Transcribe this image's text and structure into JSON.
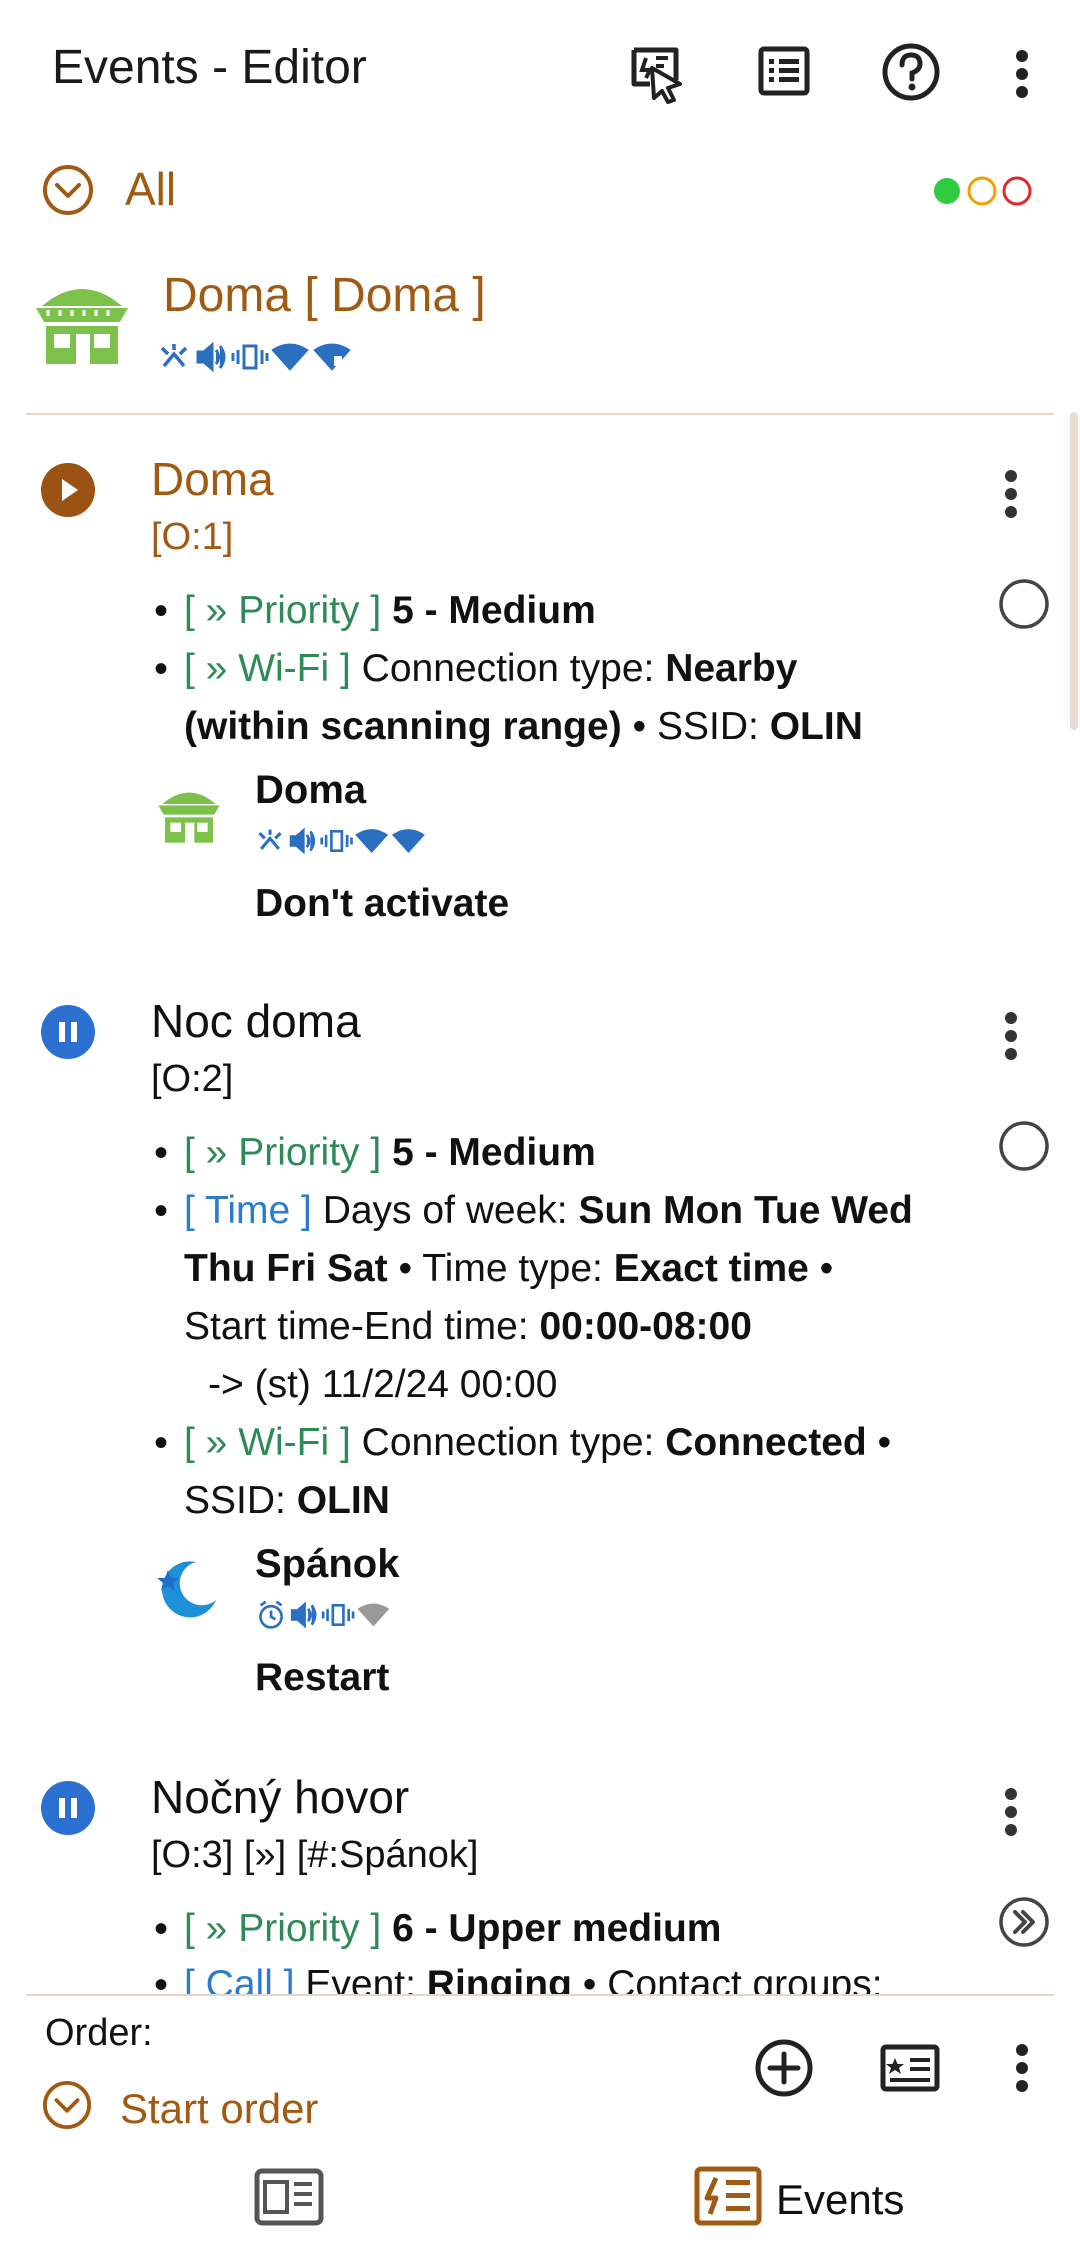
{
  "app": {
    "title": "Events - Editor",
    "toolbar_icons": [
      "run-events-icon",
      "list-icon",
      "help-icon",
      "more-vert-icon"
    ]
  },
  "filter": {
    "label": "All",
    "indicator_colors": [
      "#2ecc40",
      "#f0a000",
      "#e0282e"
    ]
  },
  "active_profile": {
    "name": "Doma [ Doma ]",
    "icon": "house-icon",
    "status_icons": [
      "airplane-mode-icon",
      "volume-icon",
      "vibrate-icon",
      "wifi-icon",
      "mobile-data-icon"
    ]
  },
  "events": [
    {
      "name": "Doma",
      "tag": "[O:1]",
      "state": "running",
      "priority_label": "[ » Priority ]",
      "priority_value": "5 - Medium",
      "wifi_label": "[ » Wi-Fi ]",
      "wifi_line1_text": "Connection type: ",
      "wifi_line1_value": "Nearby",
      "wifi_line2_value": "(within scanning range)",
      "wifi_line2_text": " • SSID: ",
      "wifi_ssid": "OLIN",
      "profile_name": "Doma",
      "profile_action": "Don't activate"
    },
    {
      "name": "Noc doma",
      "tag": "[O:2]",
      "state": "paused",
      "priority_label": "[ » Priority ]",
      "priority_value": "5 - Medium",
      "time_label": "[ Time ]",
      "time_text1": "Days of week: ",
      "time_days1": "Sun Mon Tue Wed",
      "time_days2": "Thu Fri Sat",
      "time_text2": " • Time type: ",
      "time_type": "Exact time",
      "time_text3": " •",
      "time_text4": "Start time-End time: ",
      "time_range": "00:00-08:00",
      "time_next": "-> (st) 11/2/24 00:00",
      "wifi_label": "[ » Wi-Fi ]",
      "wifi_text": "Connection type: ",
      "wifi_value": "Connected",
      "wifi_text2": " •",
      "wifi_ssid_text": "SSID: ",
      "wifi_ssid": "OLIN",
      "profile_name": "Spánok",
      "profile_action": "Restart"
    },
    {
      "name": "Nočný hovor",
      "tag": "[O:3] [»] [#:Spánok]",
      "state": "paused",
      "priority_label": "[ » Priority ]",
      "priority_value": "6 - Upper medium",
      "call_label": "[ Call ]",
      "call_text": "Event: ",
      "call_value": "Ringing",
      "call_text2": " • Contact groups:"
    }
  ],
  "bottom": {
    "order_label": "Order:",
    "start_order_label": "Start order",
    "nav_events_label": "Events"
  }
}
